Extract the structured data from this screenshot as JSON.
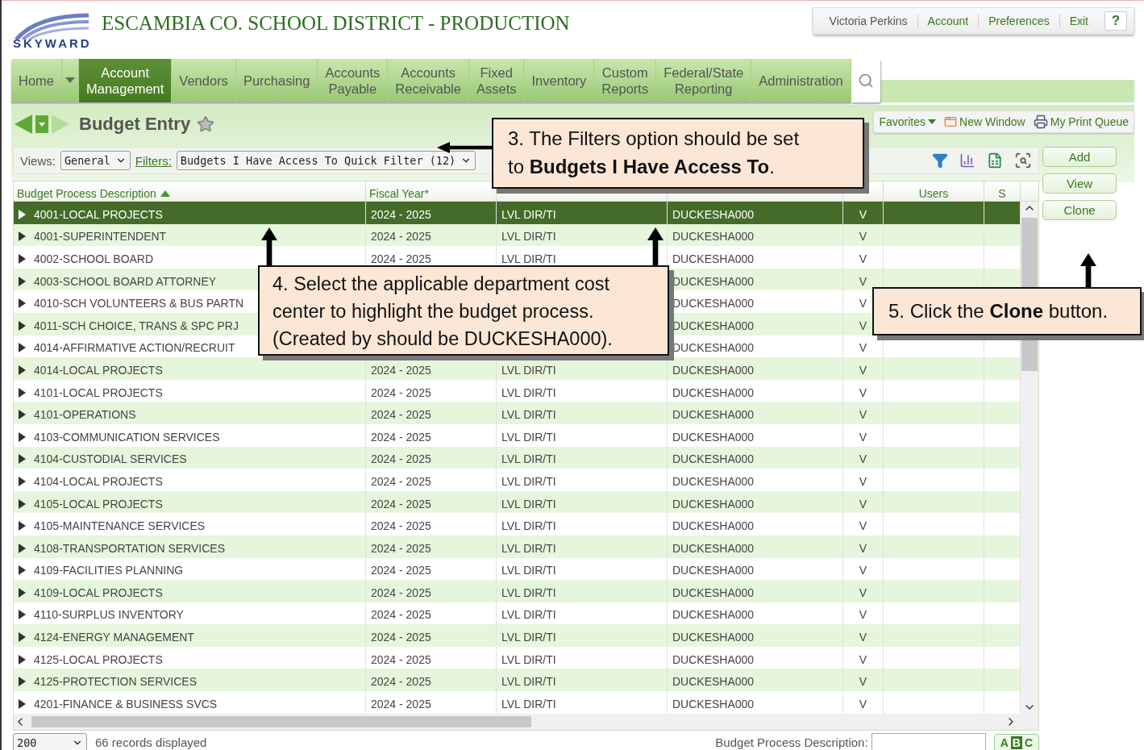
{
  "header": {
    "district_title": "ESCAMBIA CO. SCHOOL DISTRICT - PRODUCTION",
    "logo_text": "SKYWARD",
    "user_links": [
      {
        "label": "Victoria Perkins",
        "kind": "user"
      },
      {
        "label": "Account",
        "kind": "link"
      },
      {
        "label": "Preferences",
        "kind": "link"
      },
      {
        "label": "Exit",
        "kind": "link"
      }
    ],
    "help": "?"
  },
  "nav": {
    "items": [
      {
        "label": "Home",
        "selected": false
      },
      {
        "label": "Account\nManagement",
        "selected": true
      },
      {
        "label": "Vendors",
        "selected": false
      },
      {
        "label": "Purchasing",
        "selected": false
      },
      {
        "label": "Accounts\nPayable",
        "selected": false
      },
      {
        "label": "Accounts\nReceivable",
        "selected": false
      },
      {
        "label": "Fixed\nAssets",
        "selected": false
      },
      {
        "label": "Inventory",
        "selected": false
      },
      {
        "label": "Custom\nReports",
        "selected": false
      },
      {
        "label": "Federal/State\nReporting",
        "selected": false
      },
      {
        "label": "Administration",
        "selected": false
      }
    ]
  },
  "page": {
    "title": "Budget Entry"
  },
  "quick_links": [
    {
      "label": "Favorites",
      "kind": "menu"
    },
    {
      "label": "New Window",
      "kind": "window"
    },
    {
      "label": "My Print Queue",
      "kind": "print"
    }
  ],
  "views": {
    "label": "Views:",
    "value": "General"
  },
  "filters": {
    "label": "Filters:",
    "value": "Budgets I Have Access To Quick Filter (12)"
  },
  "actions": [
    "Add",
    "View",
    "Clone"
  ],
  "table": {
    "header": {
      "description": {
        "label": "Budget Process Description",
        "sorted": true
      },
      "fiscal_year": {
        "label": "Fiscal Year*"
      },
      "users": {
        "label": "Users"
      },
      "column_7": {
        "label": "S"
      }
    },
    "rows": [
      {
        "description": "4001-LOCAL PROJECTS",
        "fiscal_year": "2024 - 2025",
        "budget_type": "LVL DIR/TI",
        "created_by": "DUCKESHA000",
        "flag": "V",
        "selected": true
      },
      {
        "description": "4001-SUPERINTENDENT",
        "fiscal_year": "2024 - 2025",
        "budget_type": "LVL DIR/TI",
        "created_by": "DUCKESHA000",
        "flag": "V",
        "selected": false
      },
      {
        "description": "4002-SCHOOL BOARD",
        "fiscal_year": "2024 - 2025",
        "budget_type": "LVL DIR/TI",
        "created_by": "DUCKESHA000",
        "flag": "V",
        "selected": false
      },
      {
        "description": "4003-SCHOOL BOARD ATTORNEY",
        "created_by": "DUCKESHA000",
        "flag": "V",
        "selected": false
      },
      {
        "description": "4010-SCH VOLUNTEERS & BUS PARTN",
        "created_by": "DUCKESHA000",
        "flag": "V",
        "selected": false
      },
      {
        "description": "4011-SCH CHOICE, TRANS & SPC PRJ",
        "created_by": "DUCKESHA000",
        "flag": "V",
        "selected": false
      },
      {
        "description": "4014-AFFIRMATIVE ACTION/RECRUIT",
        "created_by": "DUCKESHA000",
        "flag": "V",
        "selected": false
      },
      {
        "description": "4014-LOCAL PROJECTS",
        "fiscal_year": "2024 - 2025",
        "budget_type": "LVL DIR/TI",
        "created_by": "DUCKESHA000",
        "flag": "V",
        "selected": false
      },
      {
        "description": "4101-LOCAL PROJECTS",
        "fiscal_year": "2024 - 2025",
        "budget_type": "LVL DIR/TI",
        "created_by": "DUCKESHA000",
        "flag": "V",
        "selected": false
      },
      {
        "description": "4101-OPERATIONS",
        "fiscal_year": "2024 - 2025",
        "budget_type": "LVL DIR/TI",
        "created_by": "DUCKESHA000",
        "flag": "V",
        "selected": false
      },
      {
        "description": "4103-COMMUNICATION SERVICES",
        "fiscal_year": "2024 - 2025",
        "budget_type": "LVL DIR/TI",
        "created_by": "DUCKESHA000",
        "flag": "V",
        "selected": false
      },
      {
        "description": "4104-CUSTODIAL SERVICES",
        "fiscal_year": "2024 - 2025",
        "budget_type": "LVL DIR/TI",
        "created_by": "DUCKESHA000",
        "flag": "V",
        "selected": false
      },
      {
        "description": "4104-LOCAL PROJECTS",
        "fiscal_year": "2024 - 2025",
        "budget_type": "LVL DIR/TI",
        "created_by": "DUCKESHA000",
        "flag": "V",
        "selected": false
      },
      {
        "description": "4105-LOCAL PROJECTS",
        "fiscal_year": "2024 - 2025",
        "budget_type": "LVL DIR/TI",
        "created_by": "DUCKESHA000",
        "flag": "V",
        "selected": false
      },
      {
        "description": "4105-MAINTENANCE SERVICES",
        "fiscal_year": "2024 - 2025",
        "budget_type": "LVL DIR/TI",
        "created_by": "DUCKESHA000",
        "flag": "V",
        "selected": false
      },
      {
        "description": "4108-TRANSPORTATION SERVICES",
        "fiscal_year": "2024 - 2025",
        "budget_type": "LVL DIR/TI",
        "created_by": "DUCKESHA000",
        "flag": "V",
        "selected": false
      },
      {
        "description": "4109-FACILITIES PLANNING",
        "fiscal_year": "2024 - 2025",
        "budget_type": "LVL DIR/TI",
        "created_by": "DUCKESHA000",
        "flag": "V",
        "selected": false
      },
      {
        "description": "4109-LOCAL PROJECTS",
        "fiscal_year": "2024 - 2025",
        "budget_type": "LVL DIR/TI",
        "created_by": "DUCKESHA000",
        "flag": "V",
        "selected": false
      },
      {
        "description": "4110-SURPLUS INVENTORY",
        "fiscal_year": "2024 - 2025",
        "budget_type": "LVL DIR/TI",
        "created_by": "DUCKESHA000",
        "flag": "V",
        "selected": false
      },
      {
        "description": "4124-ENERGY MANAGEMENT",
        "fiscal_year": "2024 - 2025",
        "budget_type": "LVL DIR/TI",
        "created_by": "DUCKESHA000",
        "flag": "V",
        "selected": false
      },
      {
        "description": "4125-LOCAL PROJECTS",
        "fiscal_year": "2024 - 2025",
        "budget_type": "LVL DIR/TI",
        "created_by": "DUCKESHA000",
        "flag": "V",
        "selected": false
      },
      {
        "description": "4125-PROTECTION SERVICES",
        "fiscal_year": "2024 - 2025",
        "budget_type": "LVL DIR/TI",
        "created_by": "DUCKESHA000",
        "flag": "V",
        "selected": false
      },
      {
        "description": "4201-FINANCE & BUSINESS SVCS",
        "fiscal_year": "2024 - 2025",
        "budget_type": "LVL DIR/TI",
        "created_by": "DUCKESHA000",
        "flag": "V",
        "selected": false
      }
    ]
  },
  "footer": {
    "page_size": "200",
    "record_count": "66 records displayed",
    "search_label": "Budget Process Description:",
    "abc": [
      "A",
      "B",
      "C"
    ]
  },
  "callouts": [
    {
      "kind": "filters",
      "text": "3. The Filters option should be set to **Budgets I Have Access To**."
    },
    {
      "kind": "row",
      "text": "4. Select the applicable department cost center to highlight the budget process. (Created by should be DUCKESHA000)."
    },
    {
      "kind": "clone",
      "text": "5. Click the **Clone** button."
    }
  ]
}
